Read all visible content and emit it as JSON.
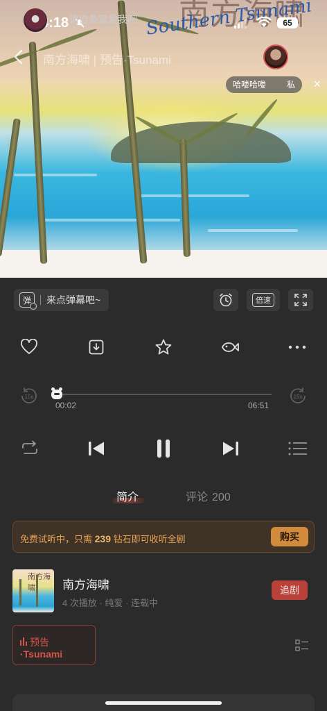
{
  "status_bar": {
    "time": "14:18",
    "battery": "65"
  },
  "header": {
    "title": "南方海啸 | 预告·Tsunami"
  },
  "cover": {
    "title_cn": "南方海啸",
    "title_script": "Southern Tsunami"
  },
  "live_chat": {
    "message": "哈喽哈喽",
    "private_label": "私"
  },
  "danmu": {
    "icon_char": "弹",
    "placeholder": "来点弹幕吧~"
  },
  "toolbar": {
    "speed_label": "倍速"
  },
  "player": {
    "current_time": "00:02",
    "total_time": "06:51",
    "progress_fraction": 0.005,
    "skip_back_label": "15s",
    "skip_fwd_label": "15s"
  },
  "tabs": [
    {
      "label": "简介",
      "active": true
    },
    {
      "label": "评论",
      "count": "200",
      "active": false
    }
  ],
  "trial": {
    "prefix": "免费试听中，只需",
    "amount": "239",
    "suffix": "钻石即可收听全剧",
    "buy_label": "购买"
  },
  "show": {
    "title": "南方海啸",
    "meta": "4 次播放 · 纯爱 · 连载中",
    "follow_label": "追剧",
    "thumb_title": "南方海啸"
  },
  "episode": {
    "line1": "预告",
    "line2": "·Tsunami"
  },
  "comment_bar": {
    "prompt": "请自备富爱我吧"
  },
  "colors": {
    "accent_red": "#b8423a",
    "accent_orange": "#d28a3c",
    "background": "#2b2b2b"
  }
}
